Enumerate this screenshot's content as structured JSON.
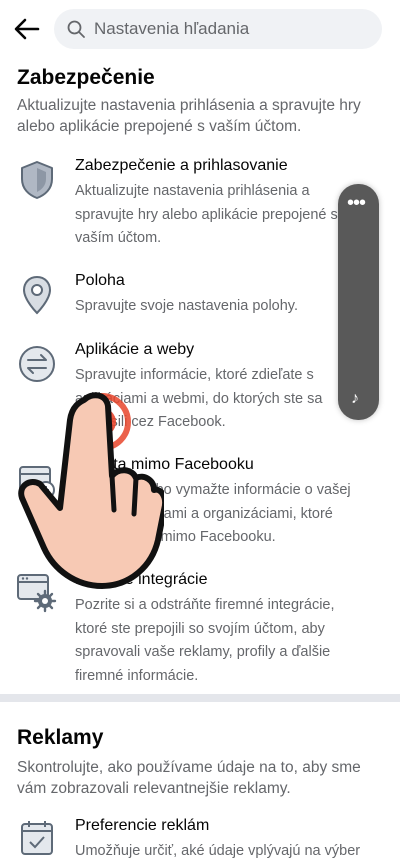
{
  "header": {
    "back_icon": "arrow-left-icon",
    "search_icon": "magnifier-icon",
    "search_placeholder": "Nastavenia hľadania"
  },
  "security": {
    "title": "Zabezpečenie",
    "description": "Aktualizujte nastavenia prihlásenia a spravujte hry alebo aplikácie prepojené s vaším účtom.",
    "items": [
      {
        "icon": "shield-icon",
        "title": "Zabezpečenie a prihlasovanie",
        "description": "Aktualizujte nastavenia prihlásenia a spravujte hry alebo aplikácie prepojené s vaším účtom."
      },
      {
        "icon": "location-pin-icon",
        "title": "Poloha",
        "description": "Spravujte svoje nastavenia polohy."
      },
      {
        "icon": "swap-arrows-icon",
        "title": "Aplikácie a weby",
        "description": "Spravujte informácie, ktoré zdieľate s aplikáciami a webmi, do ktorých ste sa prihlásili cez Facebook."
      },
      {
        "icon": "calendar-clock-icon",
        "title": "Aktivita mimo Facebooku",
        "description": "Zobrazte alebo vymažte informácie o vašej činnosti s firmami a organizáciami, ktoré navštevujete mimo Facebooku."
      },
      {
        "icon": "browser-gear-icon",
        "title": "Firemné integrácie",
        "description": "Pozrite si a odstráňte firemné integrácie, ktoré ste prepojili so svojím účtom, aby spravovali vaše reklamy, profily a ďalšie firemné informácie."
      }
    ]
  },
  "ads": {
    "title": "Reklamy",
    "description": "Skontrolujte, ako používame údaje na to, aby sme vám zobrazovali relevantnejšie reklamy.",
    "items": [
      {
        "icon": "calendar-check-icon",
        "title": "Preferencie reklám",
        "description": "Umožňuje určiť, aké údaje vplývajú na výber"
      }
    ]
  },
  "colors": {
    "icon_fill": "#b0b8c4",
    "icon_stroke": "#5e6a78",
    "accent_red": "#e8452c",
    "overlay": "#595959"
  }
}
